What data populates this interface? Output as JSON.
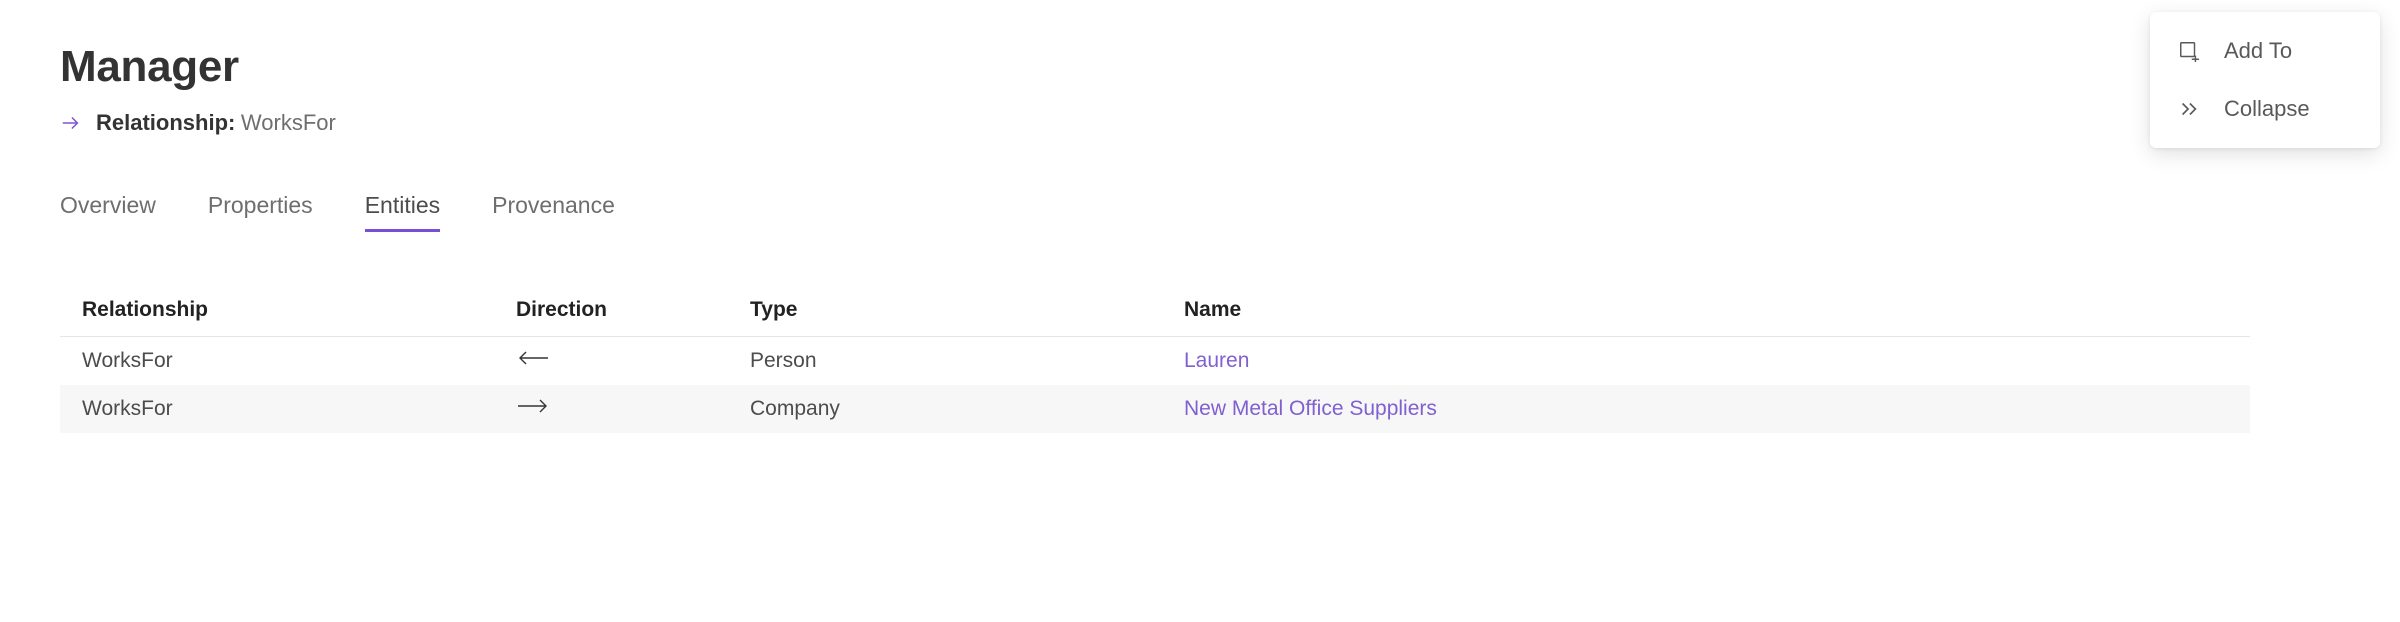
{
  "title": "Manager",
  "subtitle": {
    "label": "Relationship:",
    "value": "WorksFor"
  },
  "tabs": [
    {
      "label": "Overview",
      "active": false
    },
    {
      "label": "Properties",
      "active": false
    },
    {
      "label": "Entities",
      "active": true
    },
    {
      "label": "Provenance",
      "active": false
    }
  ],
  "columns": {
    "relationship": "Relationship",
    "direction": "Direction",
    "type": "Type",
    "name": "Name"
  },
  "rows": [
    {
      "relationship": "WorksFor",
      "direction": "left",
      "type": "Person",
      "name": "Lauren"
    },
    {
      "relationship": "WorksFor",
      "direction": "right",
      "type": "Company",
      "name": "New Metal Office Suppliers"
    }
  ],
  "menu": {
    "add_to": "Add To",
    "collapse": "Collapse"
  },
  "colors": {
    "accent": "#7a4fd6",
    "link": "#8060d0"
  }
}
